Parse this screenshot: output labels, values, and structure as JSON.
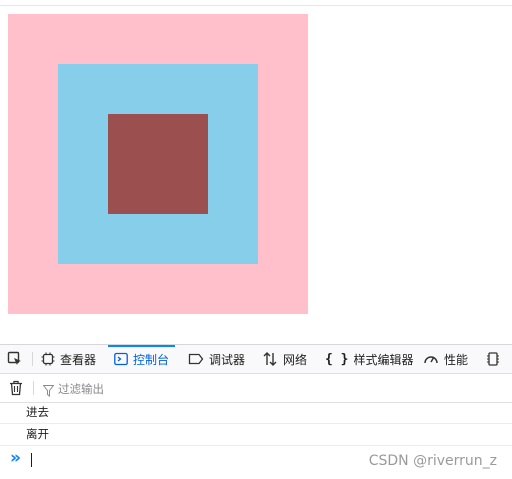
{
  "page": {
    "colors": {
      "outer_box": "#ffc0cb",
      "middle_box": "#87ceeb",
      "inner_box": "#9b4f4f"
    }
  },
  "devtools": {
    "toolbar": {
      "tabs": [
        {
          "label": "查看器",
          "icon": "inspector-icon"
        },
        {
          "label": "控制台",
          "icon": "console-icon",
          "active": true
        },
        {
          "label": "调试器",
          "icon": "debugger-icon"
        },
        {
          "label": "网络",
          "icon": "network-icon"
        },
        {
          "label": "样式编辑器",
          "icon": "style-editor-icon"
        },
        {
          "label": "性能",
          "icon": "performance-icon"
        }
      ],
      "accent_color": "#0a84ff"
    },
    "filter": {
      "placeholder": "过滤输出"
    },
    "logs": [
      {
        "text": "进去"
      },
      {
        "text": "离开"
      }
    ],
    "prompt_symbol": "»"
  },
  "watermark": "CSDN @riverrun_z"
}
